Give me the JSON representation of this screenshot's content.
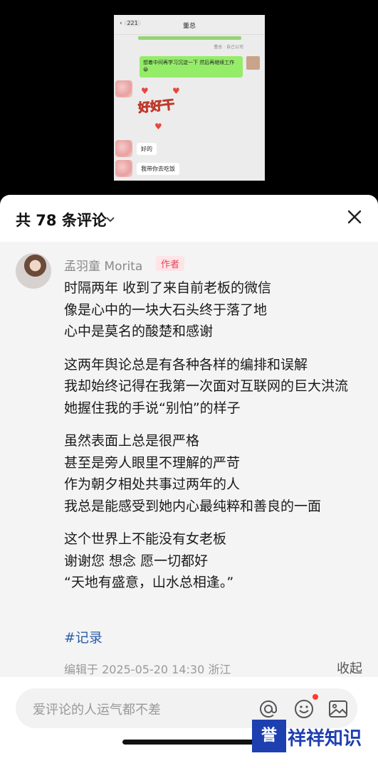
{
  "chat": {
    "back_count": "221",
    "title": "董总",
    "meta": "董总 · 自己公司",
    "bubble_right": "想着中间再学习沉淀一下 然后再继续工作😀",
    "sticker": "好好干",
    "reply_1": "好的",
    "reply_2": "我带你去吃饭"
  },
  "sheet": {
    "title": "共 78 条评论",
    "close_icon": "close-icon"
  },
  "comment": {
    "author": "孟羽童 Morita",
    "badge": "作者",
    "paragraphs": [
      [
        "时隔两年 收到了来自前老板的微信",
        "像是心中的一块大石头终于落了地",
        "心中是莫名的酸楚和感谢"
      ],
      [
        "这两年舆论总是有各种各样的编排和误解",
        "我却始终记得在我第一次面对互联网的巨大洪流",
        "她握住我的手说“别怕”的样子"
      ],
      [
        "虽然表面上总是很严格",
        "甚至是旁人眼里不理解的严苛",
        "作为朝夕相处共事过两年的人",
        "我总是能感受到她内心最纯粹和善良的一面"
      ],
      [
        "这个世界上不能没有女老板",
        "谢谢您 想念 愿一切都好",
        "“天地有盛意，山水总相逢。”"
      ]
    ],
    "tag": "#记录",
    "meta": "编辑于  2025-05-20 14:30 浙江",
    "collapse": "收起"
  },
  "input": {
    "placeholder": "爱评论的人运气都不差",
    "icons": [
      "at-icon",
      "emoji-icon",
      "image-icon"
    ]
  },
  "watermark": {
    "box_text": "誉",
    "text": "祥祥知识"
  },
  "colors": {
    "badge_bg": "#fde4e7",
    "badge_text": "#e8455a",
    "tag": "#2b5da8",
    "chat_green": "#95ec69"
  }
}
